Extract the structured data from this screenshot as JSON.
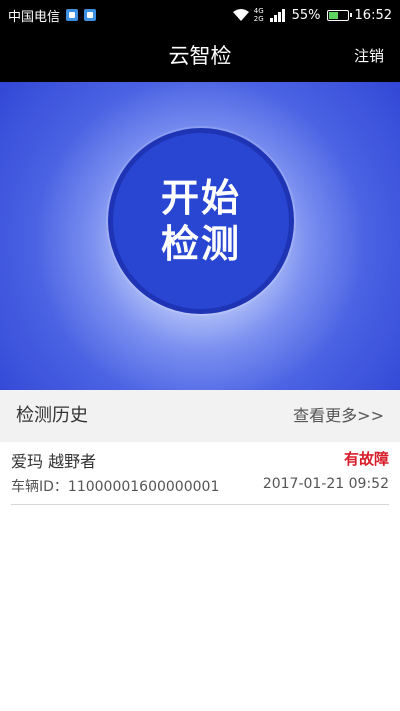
{
  "status_bar": {
    "carrier": "中国电信",
    "network": {
      "top": "4G",
      "bottom": "2G"
    },
    "battery_percent": "55%",
    "battery_level": 0.55,
    "time": "16:52",
    "icons": [
      "notification-icon",
      "app-notification-icon",
      "wifi-icon",
      "signal-icon",
      "battery-icon"
    ]
  },
  "header": {
    "title": "云智检",
    "logout_label": "注销"
  },
  "hero": {
    "button_line1": "开始",
    "button_line2": "检测"
  },
  "history": {
    "title": "检测历史",
    "view_more": "查看更多>>",
    "items": [
      {
        "vehicle": "爱玛 越野者",
        "status": "有故障",
        "id_label": "车辆ID：",
        "id_value": "11000001600000001",
        "timestamp": "2017-01-21 09:52"
      }
    ]
  },
  "colors": {
    "header_bg": "#000000",
    "hero_blue": "#3248d6",
    "button_blue": "#2846d2",
    "fault_red": "#d81e2a"
  }
}
